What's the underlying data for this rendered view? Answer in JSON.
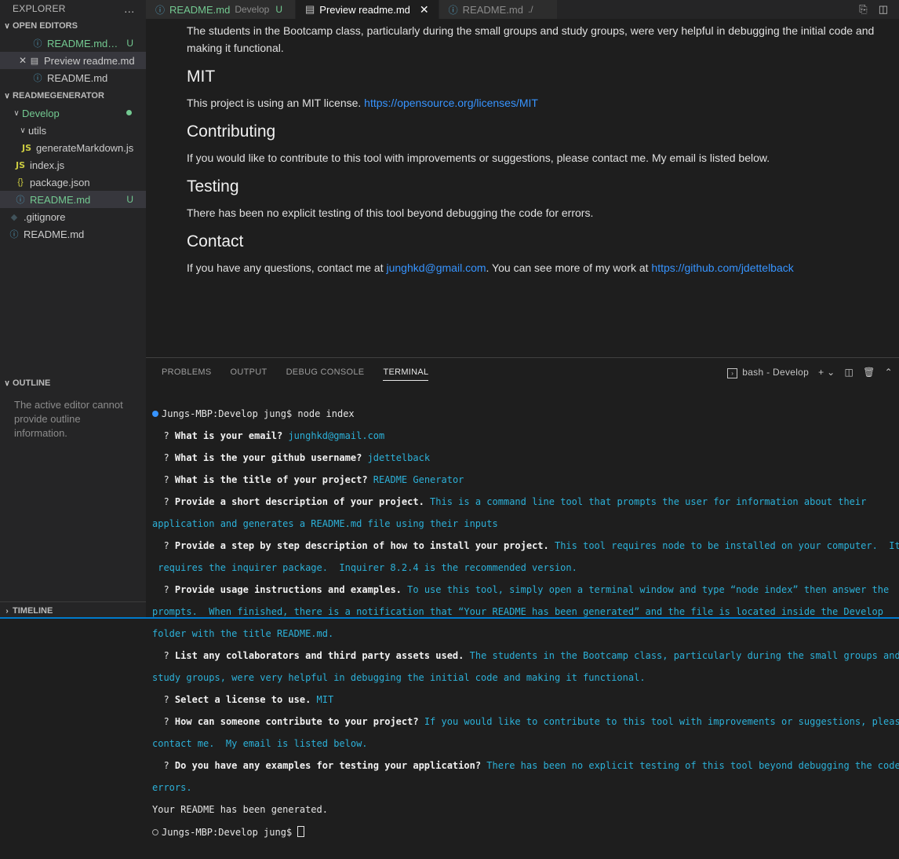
{
  "sidebar": {
    "explorer_title": "EXPLORER",
    "more_icon": "…",
    "open_editors": {
      "title": "OPEN EDITORS",
      "items": [
        {
          "label": "README.md…",
          "badge": "U"
        },
        {
          "label": "Preview readme.md"
        },
        {
          "label": "README.md"
        }
      ]
    },
    "workspace": {
      "title": "READMEGENERATOR",
      "develop": "Develop",
      "utils": "utils",
      "generate_markdown": "generateMarkdown.js",
      "index": "index.js",
      "package": "package.json",
      "readme_develop": "README.md",
      "readme_develop_badge": "U",
      "gitignore": ".gitignore",
      "readme_root": "README.md"
    },
    "outline": {
      "title": "OUTLINE",
      "message": "The active editor cannot provide outline information."
    },
    "timeline_title": "TIMELINE"
  },
  "tabs": [
    {
      "label": "README.md",
      "sub": "Develop",
      "badge": "U"
    },
    {
      "label": "Preview readme.md"
    },
    {
      "label": "README.md",
      "sub": "./"
    }
  ],
  "preview": {
    "intro": "The students in the Bootcamp class, particularly during the small groups and study groups, were very helpful in debugging the initial code and making it functional.",
    "mit_heading": "MIT",
    "mit_text": "This project is using an MIT license.",
    "mit_link": "https://opensource.org/licenses/MIT",
    "contrib_heading": "Contributing",
    "contrib_text": "If you would like to contribute to this tool with improvements or suggestions, please contact me. My email is listed below.",
    "testing_heading": "Testing",
    "testing_text": "There has been no explicit testing of this tool beyond debugging the code for errors.",
    "contact_heading": "Contact",
    "contact_pre": "If you have any questions, contact me at",
    "contact_email": "junghkd@gmail.com",
    "contact_mid": ". You can see more of my work at",
    "contact_link": "https://github.com/jdettelback"
  },
  "panel": {
    "tabs": [
      "PROBLEMS",
      "OUTPUT",
      "DEBUG CONSOLE",
      "TERMINAL"
    ],
    "terminal_name": "bash - Develop",
    "plus": "+"
  },
  "terminal": {
    "prompt1": "Jungs-MBP:Develop jung$ node index",
    "q_email": "What is your email?",
    "a_email": "junghkd@gmail.com",
    "q_github": "What is the your github username?",
    "a_github": "jdettelback",
    "q_title": "What is the title of your project?",
    "a_title": "README Generator",
    "q_desc": "Provide a short description of your project.",
    "a_desc_1": "This is a command line tool that prompts the user for information about their",
    "a_desc_2": "application and generates a README.md file using their inputs",
    "q_install": "Provide a step by step description of how to install your project.",
    "a_install_1": "This tool requires node to be installed on your computer.  It also",
    "a_install_2": " requires the inquirer package.  Inquirer 8.2.4 is the recommended version.",
    "q_usage": "Provide usage instructions and examples.",
    "a_usage_1": "To use this tool, simply open a terminal window and type “node index” then answer the",
    "a_usage_2": "prompts.  When finished, there is a notification that “Your README has been generated” and the file is located inside the Develop",
    "a_usage_3": "folder with the title README.md.",
    "q_collab": "List any collaborators and third party assets used.",
    "a_collab_1": "The students in the Bootcamp class, particularly during the small groups and",
    "a_collab_2": "study groups, were very helpful in debugging the initial code and making it functional.",
    "q_license": "Select a license to use.",
    "a_license": "MIT",
    "q_contrib": "How can someone contribute to your project?",
    "a_contrib_1": "If you would like to contribute to this tool with improvements or suggestions, please",
    "a_contrib_2": "contact me.  My email is listed below.",
    "q_testing": "Do you have any examples for testing your application?",
    "a_testing_1": "There has been no explicit testing of this tool beyond debugging the code for",
    "a_testing_2": "errors.",
    "done": "Your README has been generated.",
    "prompt2": "Jungs-MBP:Develop jung$"
  }
}
